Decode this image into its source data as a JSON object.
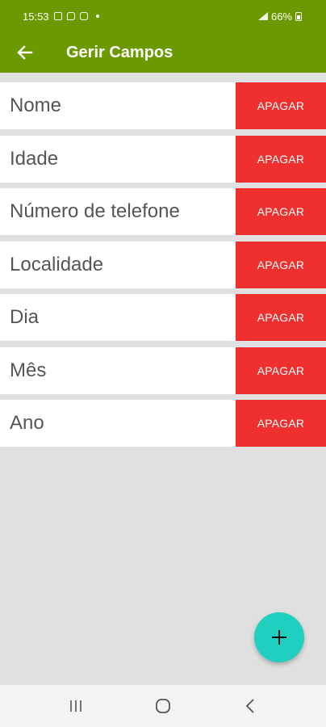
{
  "status_bar": {
    "time": "15:53",
    "battery": "66%",
    "icons": [
      "gallery-icon",
      "message-icon",
      "instagram-icon",
      "dot-icon",
      "signal-icon",
      "battery-icon"
    ]
  },
  "app_bar": {
    "title": "Gerir Campos",
    "back_icon": "arrow-left-icon"
  },
  "fields": [
    {
      "label": "Nome",
      "delete_label": "APAGAR"
    },
    {
      "label": "Idade",
      "delete_label": "APAGAR"
    },
    {
      "label": "Número de telefone",
      "delete_label": "APAGAR"
    },
    {
      "label": "Localidade",
      "delete_label": "APAGAR"
    },
    {
      "label": "Dia",
      "delete_label": "APAGAR"
    },
    {
      "label": "Mês",
      "delete_label": "APAGAR"
    },
    {
      "label": "Ano",
      "delete_label": "APAGAR"
    }
  ],
  "fab": {
    "icon": "plus-icon"
  },
  "nav_bar": {
    "icons": [
      "recents-icon",
      "home-icon",
      "back-icon"
    ]
  },
  "colors": {
    "app_bar": "#6a9a00",
    "delete_button": "#f0302e",
    "fab": "#1fd0c0",
    "background": "#e0e0e0",
    "label_text": "#555555"
  }
}
